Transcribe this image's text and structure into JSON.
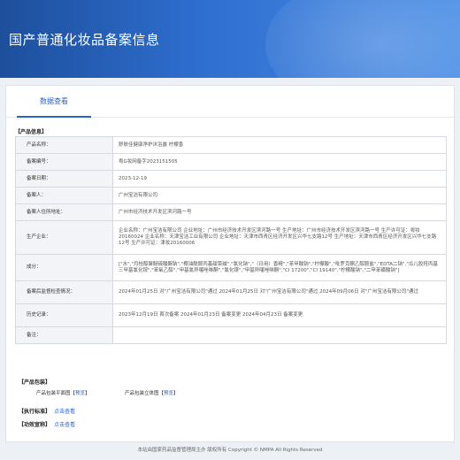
{
  "header": {
    "title": "国产普通化妆品备案信息"
  },
  "tabs": [
    {
      "label": "数据查看"
    }
  ],
  "sections": {
    "product_info": "【产品信息】",
    "packaging": "【产品包装】",
    "standard": "【执行标准】",
    "efficacy": "【功效宣称】"
  },
  "rows": [
    {
      "label": "产品名称：",
      "value": "舒肤佳健康净护沐浴露 柠檬香"
    },
    {
      "label": "备案编号：",
      "value": "粤G妆网备字2023151505"
    },
    {
      "label": "备案日期：",
      "value": "2023-12-19"
    },
    {
      "label": "备案人：",
      "value": "广州宝洁有限公司"
    },
    {
      "label": "备案人住所地址：",
      "value": "广州市经济技术开发区滨河路一号"
    },
    {
      "label": "生产企业：",
      "value": "企业名称：广州宝洁有限公司 企业地址：广州市经济技术开发区滨河路一号 生产地址：广州市经济技术开发区滨河路一号 生产许可证：粤妆20160024 企业名称：天津宝洁工业有限公司 企业地址：天津市西青区经济开发区兴华七支路12号 生产地址：天津市西青区经济开发区兴华七支路12号 生产许可证：津妆20160006"
    },
    {
      "label": "成分：",
      "value": "[\"水\",\"月桂醇聚醚硫酸酯钠\",\"椰油酰胺丙基甜菜碱\",\"氯化钠\",\"（日用）香精\",\"苯甲酸钠\",\"柠檬酸\",\"吡罗克酮乙醇胺盐\",\"EDTA二钠\",\"瓜儿胶羟丙基三甲基氯化铵\",\"苯氧乙醇\",\"甲基氯异噻唑啉酮\",\"氯化镁\",\"甲基异噻唑啉酮\",\"CI 17200\",\"CI 19140\",\"柠檬酸钠\",\"二甲苯磺酸钠\"]"
    },
    {
      "label": "备案后监督检查情况：",
      "value": "2024年01月25日 对\"广州宝洁有限公司\"通过 2024年01月25日 对\"广州宝洁有限公司\"通过 2024年09月06日 对\"广州宝洁有限公司\"通过"
    },
    {
      "label": "历史记录：",
      "value": "2023年12月19日 首次备案 2024年01月23日 备案变更 2024年04月23日 备案变更"
    },
    {
      "label": "备注：",
      "value": ""
    }
  ],
  "packaging": [
    {
      "name": "产品包装平面图",
      "link": "预览"
    },
    {
      "name": "产品包装立体图",
      "link": "预览"
    }
  ],
  "links": {
    "standard": "点击查看",
    "efficacy": "点击查看"
  },
  "footer": {
    "text": "本站由国家药品监督管理局主办 版权所有 Copyright © NMPA All Rights Reserved"
  }
}
